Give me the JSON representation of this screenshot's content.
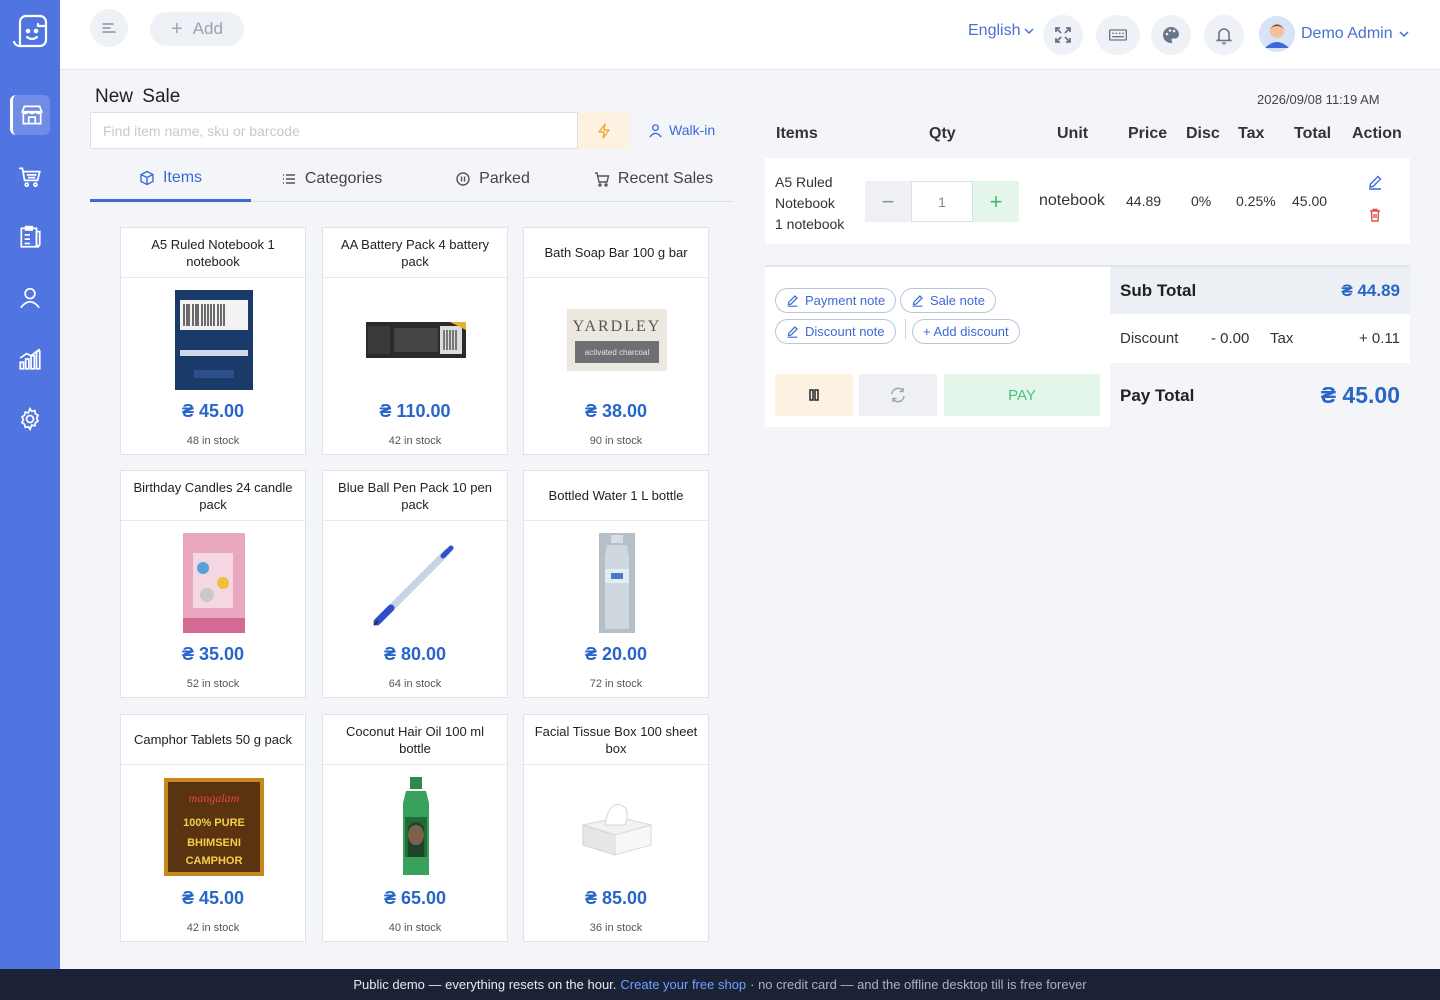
{
  "header": {
    "add_label": "Add",
    "language": "English",
    "user_name": "Demo Admin"
  },
  "sale": {
    "title": "New Sale",
    "datetime": "2026/09/08 11:19 AM",
    "search_placeholder": "Find item name, sku or barcode",
    "customer": "Walk-in"
  },
  "tabs": [
    {
      "label": "Items",
      "icon": "box-icon"
    },
    {
      "label": "Categories",
      "icon": "list-icon"
    },
    {
      "label": "Parked",
      "icon": "pause-circle-icon"
    },
    {
      "label": "Recent Sales",
      "icon": "cart-icon"
    }
  ],
  "products": [
    {
      "name": "A5 Ruled Notebook 1 notebook",
      "price": "₴ 45.00",
      "stock": "48 in stock"
    },
    {
      "name": "AA Battery Pack 4 battery pack",
      "price": "₴ 110.00",
      "stock": "42 in stock"
    },
    {
      "name": "Bath Soap Bar 100 g bar",
      "price": "₴ 38.00",
      "stock": "90 in stock"
    },
    {
      "name": "Birthday Candles 24 candle pack",
      "price": "₴ 35.00",
      "stock": "52 in stock"
    },
    {
      "name": "Blue Ball Pen Pack 10 pen pack",
      "price": "₴ 80.00",
      "stock": "64 in stock"
    },
    {
      "name": "Bottled Water 1 L bottle",
      "price": "₴ 20.00",
      "stock": "72 in stock"
    },
    {
      "name": "Camphor Tablets 50 g pack",
      "price": "₴ 45.00",
      "stock": "42 in stock"
    },
    {
      "name": "Coconut Hair Oil 100 ml bottle",
      "price": "₴ 65.00",
      "stock": "40 in stock"
    },
    {
      "name": "Facial Tissue Box 100 sheet box",
      "price": "₴ 85.00",
      "stock": "36 in stock"
    }
  ],
  "product_images": {
    "soap_brand": "YARDLEY",
    "soap_sub": "activated charcoal",
    "camphor_brand": "mangalam",
    "camphor_line1": "100% PURE",
    "camphor_line2": "BHIMSENI",
    "camphor_line3": "CAMPHOR"
  },
  "cart": {
    "columns": {
      "items": "Items",
      "qty": "Qty",
      "unit": "Unit",
      "price": "Price",
      "disc": "Disc",
      "tax": "Tax",
      "total": "Total",
      "action": "Action"
    },
    "rows": [
      {
        "name_line1": "A5 Ruled",
        "name_line2": "Notebook",
        "name_line3": "1 notebook",
        "qty": "1",
        "unit": "notebook",
        "price": "44.89",
        "disc": "0%",
        "tax": "0.25%",
        "total": "45.00"
      }
    ]
  },
  "notes": {
    "payment_note": "Payment note",
    "sale_note": "Sale note",
    "discount_note": "Discount note",
    "add_discount": "+ Add discount"
  },
  "totals": {
    "subtotal_label": "Sub Total",
    "subtotal_value": "₴ 44.89",
    "discount_label": "Discount",
    "discount_value": "- 0.00",
    "tax_label": "Tax",
    "tax_value": "+ 0.11",
    "pay_label": "PAY",
    "paytotal_label": "Pay Total",
    "paytotal_value": "₴ 45.00"
  },
  "footer": {
    "text1": "Public demo — everything resets on the hour.",
    "link": "Create your free shop",
    "text2": "· no credit card — and the offline desktop till is free forever"
  },
  "colors": {
    "sidebar": "#5175e0",
    "accent": "#3b6ad6",
    "price": "#2766c8",
    "pay_green": "#49c07a",
    "footer": "#1c2235"
  }
}
